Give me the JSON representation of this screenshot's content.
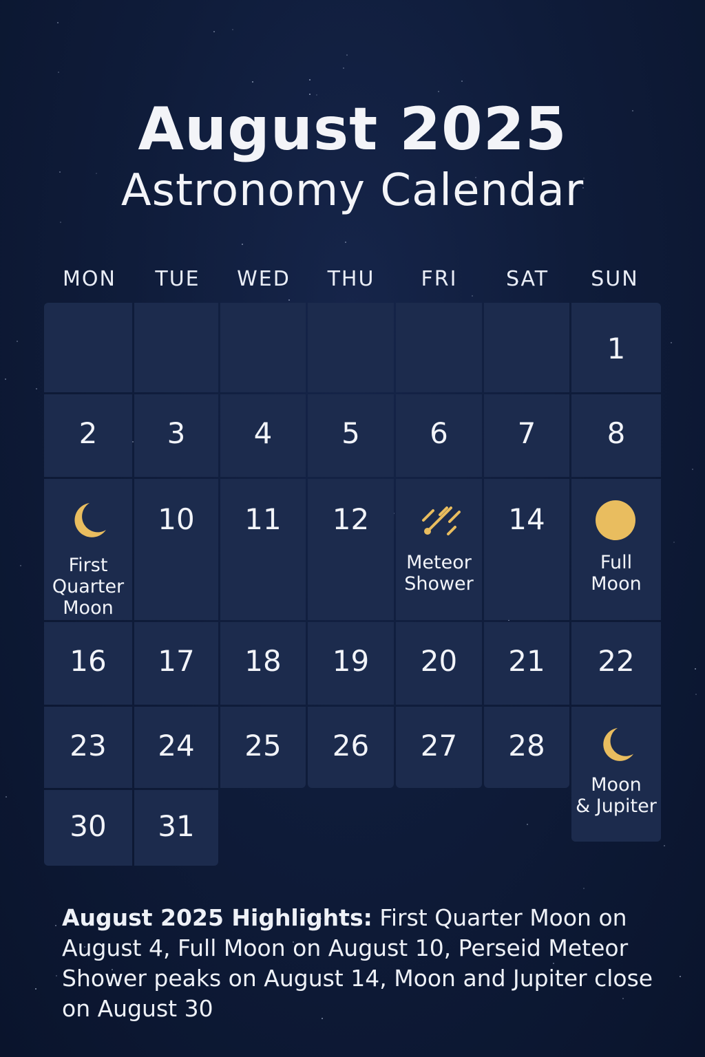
{
  "header": {
    "title": "August 2025",
    "subtitle": "Astronomy Calendar"
  },
  "weekdays": [
    "MON",
    "TUE",
    "WED",
    "THU",
    "FRI",
    "SAT",
    "SUN"
  ],
  "days": {
    "d1": "1",
    "d2": "2",
    "d3": "3",
    "d4": "4",
    "d5": "5",
    "d6": "6",
    "d7": "7",
    "d8": "8",
    "d10": "10",
    "d11": "11",
    "d12": "12",
    "d14": "14",
    "d16": "16",
    "d17": "17",
    "d18": "18",
    "d19": "19",
    "d20": "20",
    "d21": "21",
    "d22": "22",
    "d23": "23",
    "d24": "24",
    "d25": "25",
    "d26": "26",
    "d27": "27",
    "d28": "28",
    "d30": "30",
    "d31": "31"
  },
  "events": {
    "first_quarter": {
      "label": "First\nQuarter\nMoon",
      "icon": "crescent-moon-icon"
    },
    "meteor": {
      "label": "Meteor\nShower",
      "icon": "meteor-icon"
    },
    "full_moon": {
      "label": "Full\nMoon",
      "icon": "full-moon-icon"
    },
    "moon_jupiter": {
      "label": "Moon\n& Jupiter",
      "icon": "crescent-moon-icon"
    }
  },
  "highlights": {
    "lead": "August 2025 Highlights:",
    "text": " First Quarter Moon on August 4, Full Moon on August 10, Perseid Meteor Shower peaks on August 14, Moon and Jupiter close on August 30"
  },
  "colors": {
    "background": "#0f1c3a",
    "cell": "#1c2b4d",
    "accent_gold": "#e9bd5f",
    "text": "#f2f4f9"
  }
}
